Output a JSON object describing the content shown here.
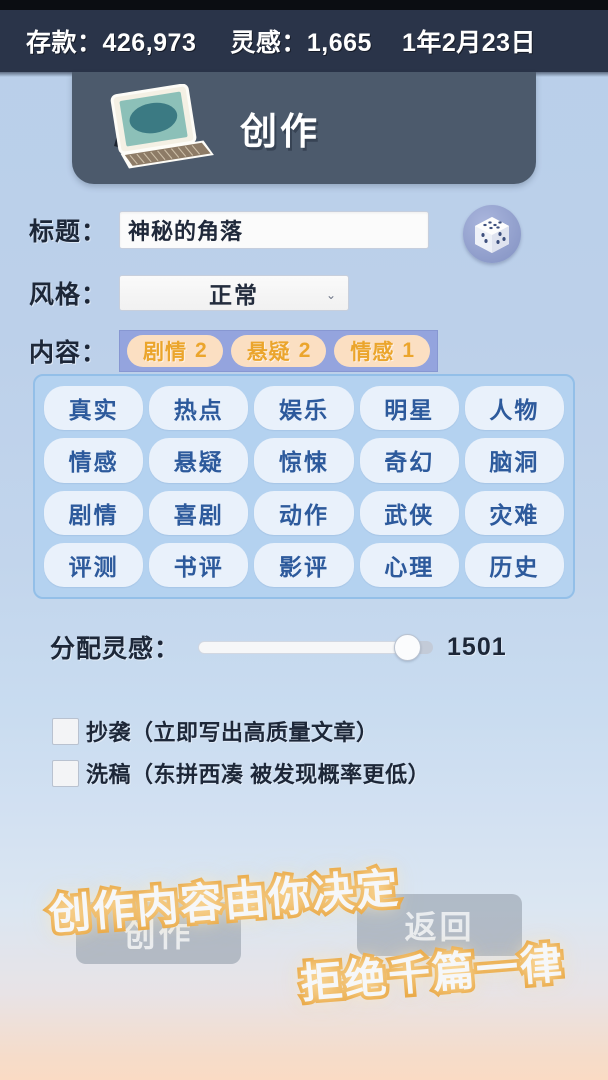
{
  "statusbar": {
    "money_label": "存款：426,973",
    "inspiration_label": "灵感：1,665",
    "date_label": "1年2月23日"
  },
  "header": {
    "title": "创作",
    "icon": "laptop-icon"
  },
  "form": {
    "title_field": {
      "label": "标题：",
      "value": "神秘的角落",
      "placeholder": ""
    },
    "dice_button": {
      "icon": "dice-icon"
    },
    "style_field": {
      "label": "风格：",
      "value": "正常",
      "chevron": "⌄"
    },
    "content_field": {
      "label": "内容："
    },
    "selected_tags": [
      {
        "name": "剧情",
        "count": "2"
      },
      {
        "name": "悬疑",
        "count": "2"
      },
      {
        "name": "情感",
        "count": "1"
      }
    ],
    "tags": [
      "真实",
      "热点",
      "娱乐",
      "明星",
      "人物",
      "情感",
      "悬疑",
      "惊悚",
      "奇幻",
      "脑洞",
      "剧情",
      "喜剧",
      "动作",
      "武侠",
      "灾难",
      "评测",
      "书评",
      "影评",
      "心理",
      "历史"
    ],
    "slider": {
      "label": "分配灵感：",
      "value": "1501",
      "percent": 89
    },
    "checkboxes": [
      {
        "label": "抄袭（立即写出高质量文章）",
        "checked": false
      },
      {
        "label": "洗稿（东拼西凑  被发现概率更低）",
        "checked": false
      }
    ]
  },
  "actions": {
    "create_label": "创作",
    "back_label": "返回"
  },
  "promo": {
    "line1": "创作内容由你决定",
    "line2": "拒绝千篇一律"
  },
  "colors": {
    "topbar_bg": "#2a3449",
    "header_panel": "#4c5a6c",
    "page_bg_top": "#b9cfea",
    "page_bg_bottom": "#fadbc4",
    "tag_text": "#2d5a9c",
    "tag_bg": "#e9f1fb",
    "tag_grid_bg": "#b4d2f0",
    "selected_strip_bg": "#94a4de",
    "selected_pill_bg": "#fbdfc2",
    "selected_pill_text": "#eba52c",
    "promo_stroke": "#e8a33c"
  }
}
